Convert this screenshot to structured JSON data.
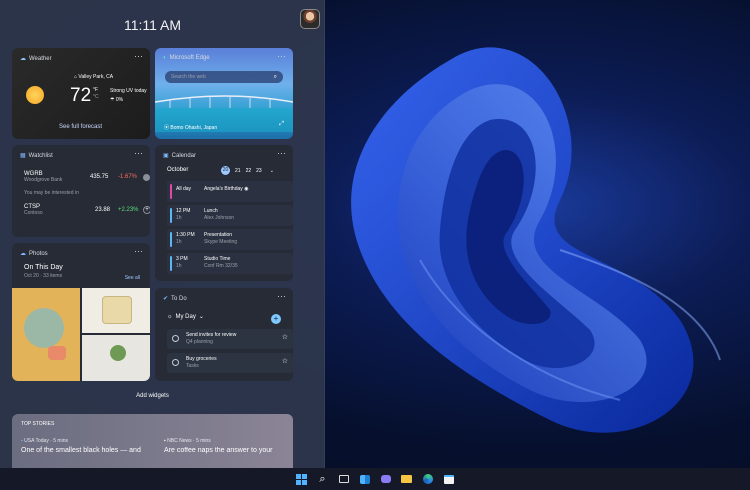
{
  "clock": "11:11 AM",
  "weather": {
    "title": "Weather",
    "location": "Valley Park, CA",
    "temp": "72",
    "unit_f": "°F",
    "unit_c": "°C",
    "condition": "Strong UV today",
    "precip": "0%",
    "link": "See full forecast"
  },
  "edge": {
    "title": "Microsoft Edge",
    "search_placeholder": "Search the web",
    "caption": "Bomo Ohashi, Japan"
  },
  "watchlist": {
    "title": "Watchlist",
    "stocks": [
      {
        "symbol": "WGRB",
        "name": "Woodgrove Bank",
        "price": "435.75",
        "change": "-1.67%",
        "color": "#ff6b5f"
      },
      {
        "symbol": "CTSP",
        "name": "Contoso",
        "price": "23.88",
        "change": "+2.23%",
        "color": "#5ee07a"
      }
    ],
    "interest": "You may be interested in"
  },
  "calendar": {
    "title": "Calendar",
    "month": "October",
    "days": [
      "20",
      "21",
      "22",
      "23"
    ],
    "events": [
      {
        "time": "All day",
        "dur": "",
        "title": "Angela's Birthday",
        "sub": "",
        "color": "#e04aa0"
      },
      {
        "time": "12 PM",
        "dur": "1h",
        "title": "Lunch",
        "sub": "Alex Johnson",
        "color": "#5ab8f0"
      },
      {
        "time": "1:30 PM",
        "dur": "1h",
        "title": "Presentation",
        "sub": "Skype Meeting",
        "color": "#5ab8f0"
      },
      {
        "time": "3 PM",
        "dur": "1h",
        "title": "Studio Time",
        "sub": "Conf Rm 32/35",
        "color": "#5ab8f0"
      }
    ]
  },
  "photos": {
    "title": "Photos",
    "heading": "On This Day",
    "sub": "Oct 20 · 33 items",
    "link": "See all"
  },
  "todo": {
    "title": "To Do",
    "list": "My Day",
    "items": [
      {
        "title": "Send invites for review",
        "sub": "Q4 planning"
      },
      {
        "title": "Buy groceries",
        "sub": "Tasks"
      }
    ]
  },
  "add_widgets": "Add widgets",
  "stories": {
    "title": "TOP STORIES",
    "items": [
      {
        "source": "USA Today · 5 mins",
        "headline": "One of the smallest black holes — and"
      },
      {
        "source": "NBC News · 5 mins",
        "headline": "Are coffee naps the answer to your"
      }
    ]
  },
  "taskbar": [
    "start-icon",
    "search-icon",
    "task-view-icon",
    "widgets-icon",
    "chat-icon",
    "file-explorer-icon",
    "edge-icon",
    "store-icon"
  ]
}
